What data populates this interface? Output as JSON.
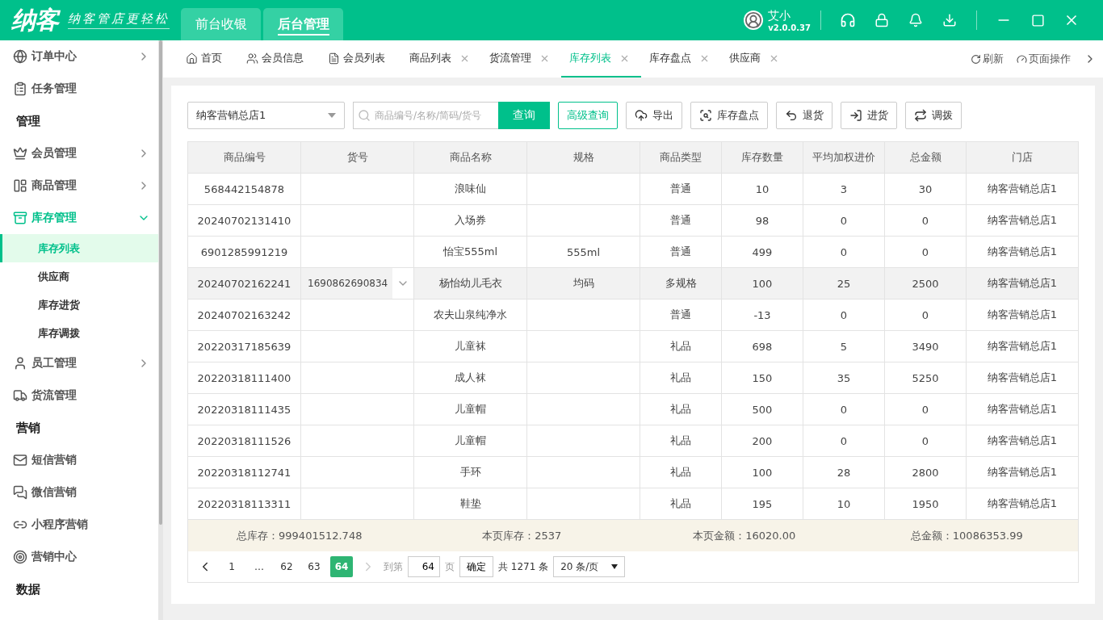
{
  "app": {
    "logo": "纳客",
    "slogan": "纳客管店更轻松",
    "modes": [
      {
        "label": "前台收银",
        "selected": false
      },
      {
        "label": "后台管理",
        "selected": true
      }
    ],
    "user": {
      "name": "艾小",
      "version": "v2.0.0.37"
    }
  },
  "sidebar": {
    "items": [
      {
        "kind": "item",
        "label": "订单中心",
        "expandable": true,
        "expanded": false
      },
      {
        "kind": "item",
        "label": "任务管理",
        "expandable": false,
        "expanded": false
      },
      {
        "kind": "section",
        "label": "管理"
      },
      {
        "kind": "item",
        "label": "会员管理",
        "expandable": true,
        "expanded": false
      },
      {
        "kind": "item",
        "label": "商品管理",
        "expandable": true,
        "expanded": false
      },
      {
        "kind": "item",
        "label": "库存管理",
        "expandable": true,
        "expanded": true
      },
      {
        "kind": "sub",
        "label": "库存列表",
        "selected": true
      },
      {
        "kind": "sub",
        "label": "供应商",
        "selected": false
      },
      {
        "kind": "sub",
        "label": "库存进货",
        "selected": false
      },
      {
        "kind": "sub",
        "label": "库存调拨",
        "selected": false
      },
      {
        "kind": "item",
        "label": "员工管理",
        "expandable": true,
        "expanded": false
      },
      {
        "kind": "item",
        "label": "货流管理",
        "expandable": false,
        "expanded": false
      },
      {
        "kind": "section",
        "label": "营销"
      },
      {
        "kind": "item",
        "label": "短信营销",
        "expandable": false,
        "expanded": false
      },
      {
        "kind": "item",
        "label": "微信营销",
        "expandable": false,
        "expanded": false
      },
      {
        "kind": "item",
        "label": "小程序营销",
        "expandable": false,
        "expanded": false
      },
      {
        "kind": "item",
        "label": "营销中心",
        "expandable": false,
        "expanded": false
      },
      {
        "kind": "section",
        "label": "数据"
      }
    ]
  },
  "page_tabs": [
    {
      "label": "首页",
      "closable": false,
      "selected": false
    },
    {
      "label": "会员信息",
      "closable": false,
      "selected": false
    },
    {
      "label": "会员列表",
      "closable": false,
      "selected": false
    },
    {
      "label": "商品列表",
      "closable": true,
      "selected": false
    },
    {
      "label": "货流管理",
      "closable": true,
      "selected": false
    },
    {
      "label": "库存列表",
      "closable": true,
      "selected": true
    },
    {
      "label": "库存盘点",
      "closable": true,
      "selected": false
    },
    {
      "label": "供应商",
      "closable": true,
      "selected": false
    }
  ],
  "tab_actions": [
    "刷新",
    "页面操作"
  ],
  "toolbar": {
    "store": "纳客营销总店1",
    "search_placeholder": "商品编号/名称/简码/货号",
    "search_button": "查询",
    "advanced": "高级查询",
    "actions": [
      "导出",
      "库存盘点",
      "退货",
      "进货",
      "调拨"
    ]
  },
  "table": {
    "columns": [
      "商品编号",
      "货号",
      "商品名称",
      "规格",
      "商品类型",
      "库存数量",
      "平均加权进价",
      "总金额",
      "门店"
    ],
    "rows": [
      {
        "selected": false,
        "variants": false,
        "cells": [
          "568442154878",
          "",
          "浪味仙",
          "",
          "普通",
          "10",
          "3",
          "30",
          "纳客营销总店1"
        ]
      },
      {
        "selected": false,
        "variants": false,
        "cells": [
          "20240702131410",
          "",
          "入场券",
          "",
          "普通",
          "98",
          "0",
          "0",
          "纳客营销总店1"
        ]
      },
      {
        "selected": false,
        "variants": false,
        "cells": [
          "6901285991219",
          "",
          "怡宝555ml",
          "555ml",
          "普通",
          "499",
          "0",
          "0",
          "纳客营销总店1"
        ]
      },
      {
        "selected": true,
        "variants": true,
        "cells": [
          "20240702162241",
          "1690862690834",
          "杨怡幼儿毛衣",
          "均码",
          "多规格",
          "100",
          "25",
          "2500",
          "纳客营销总店1"
        ]
      },
      {
        "selected": false,
        "variants": false,
        "cells": [
          "20240702163242",
          "",
          "农夫山泉纯净水",
          "",
          "普通",
          "-13",
          "0",
          "0",
          "纳客营销总店1"
        ]
      },
      {
        "selected": false,
        "variants": false,
        "cells": [
          "20220317185639",
          "",
          "儿童袜",
          "",
          "礼品",
          "698",
          "5",
          "3490",
          "纳客营销总店1"
        ]
      },
      {
        "selected": false,
        "variants": false,
        "cells": [
          "20220318111400",
          "",
          "成人袜",
          "",
          "礼品",
          "150",
          "35",
          "5250",
          "纳客营销总店1"
        ]
      },
      {
        "selected": false,
        "variants": false,
        "cells": [
          "20220318111435",
          "",
          "儿童帽",
          "",
          "礼品",
          "500",
          "0",
          "0",
          "纳客营销总店1"
        ]
      },
      {
        "selected": false,
        "variants": false,
        "cells": [
          "20220318111526",
          "",
          "儿童帽",
          "",
          "礼品",
          "200",
          "0",
          "0",
          "纳客营销总店1"
        ]
      },
      {
        "selected": false,
        "variants": false,
        "cells": [
          "20220318112741",
          "",
          "手环",
          "",
          "礼品",
          "100",
          "28",
          "2800",
          "纳客营销总店1"
        ]
      },
      {
        "selected": false,
        "variants": false,
        "cells": [
          "20220318113311",
          "",
          "鞋垫",
          "",
          "礼品",
          "195",
          "10",
          "1950",
          "纳客营销总店1"
        ]
      }
    ]
  },
  "summary": [
    "总库存：999401512.748",
    "本页库存：2537",
    "本页金额：16020.00",
    "总金额：10086353.99"
  ],
  "pagination": {
    "pages": [
      {
        "label": "1",
        "selected": false
      },
      {
        "label": "…",
        "selected": false
      },
      {
        "label": "62",
        "selected": false
      },
      {
        "label": "63",
        "selected": false
      },
      {
        "label": "64",
        "selected": true
      }
    ],
    "goto_label": "到第",
    "goto_value": "64",
    "page_unit": "页",
    "confirm": "确定",
    "total": "共 1271 条",
    "page_size": "20 条/页"
  }
}
